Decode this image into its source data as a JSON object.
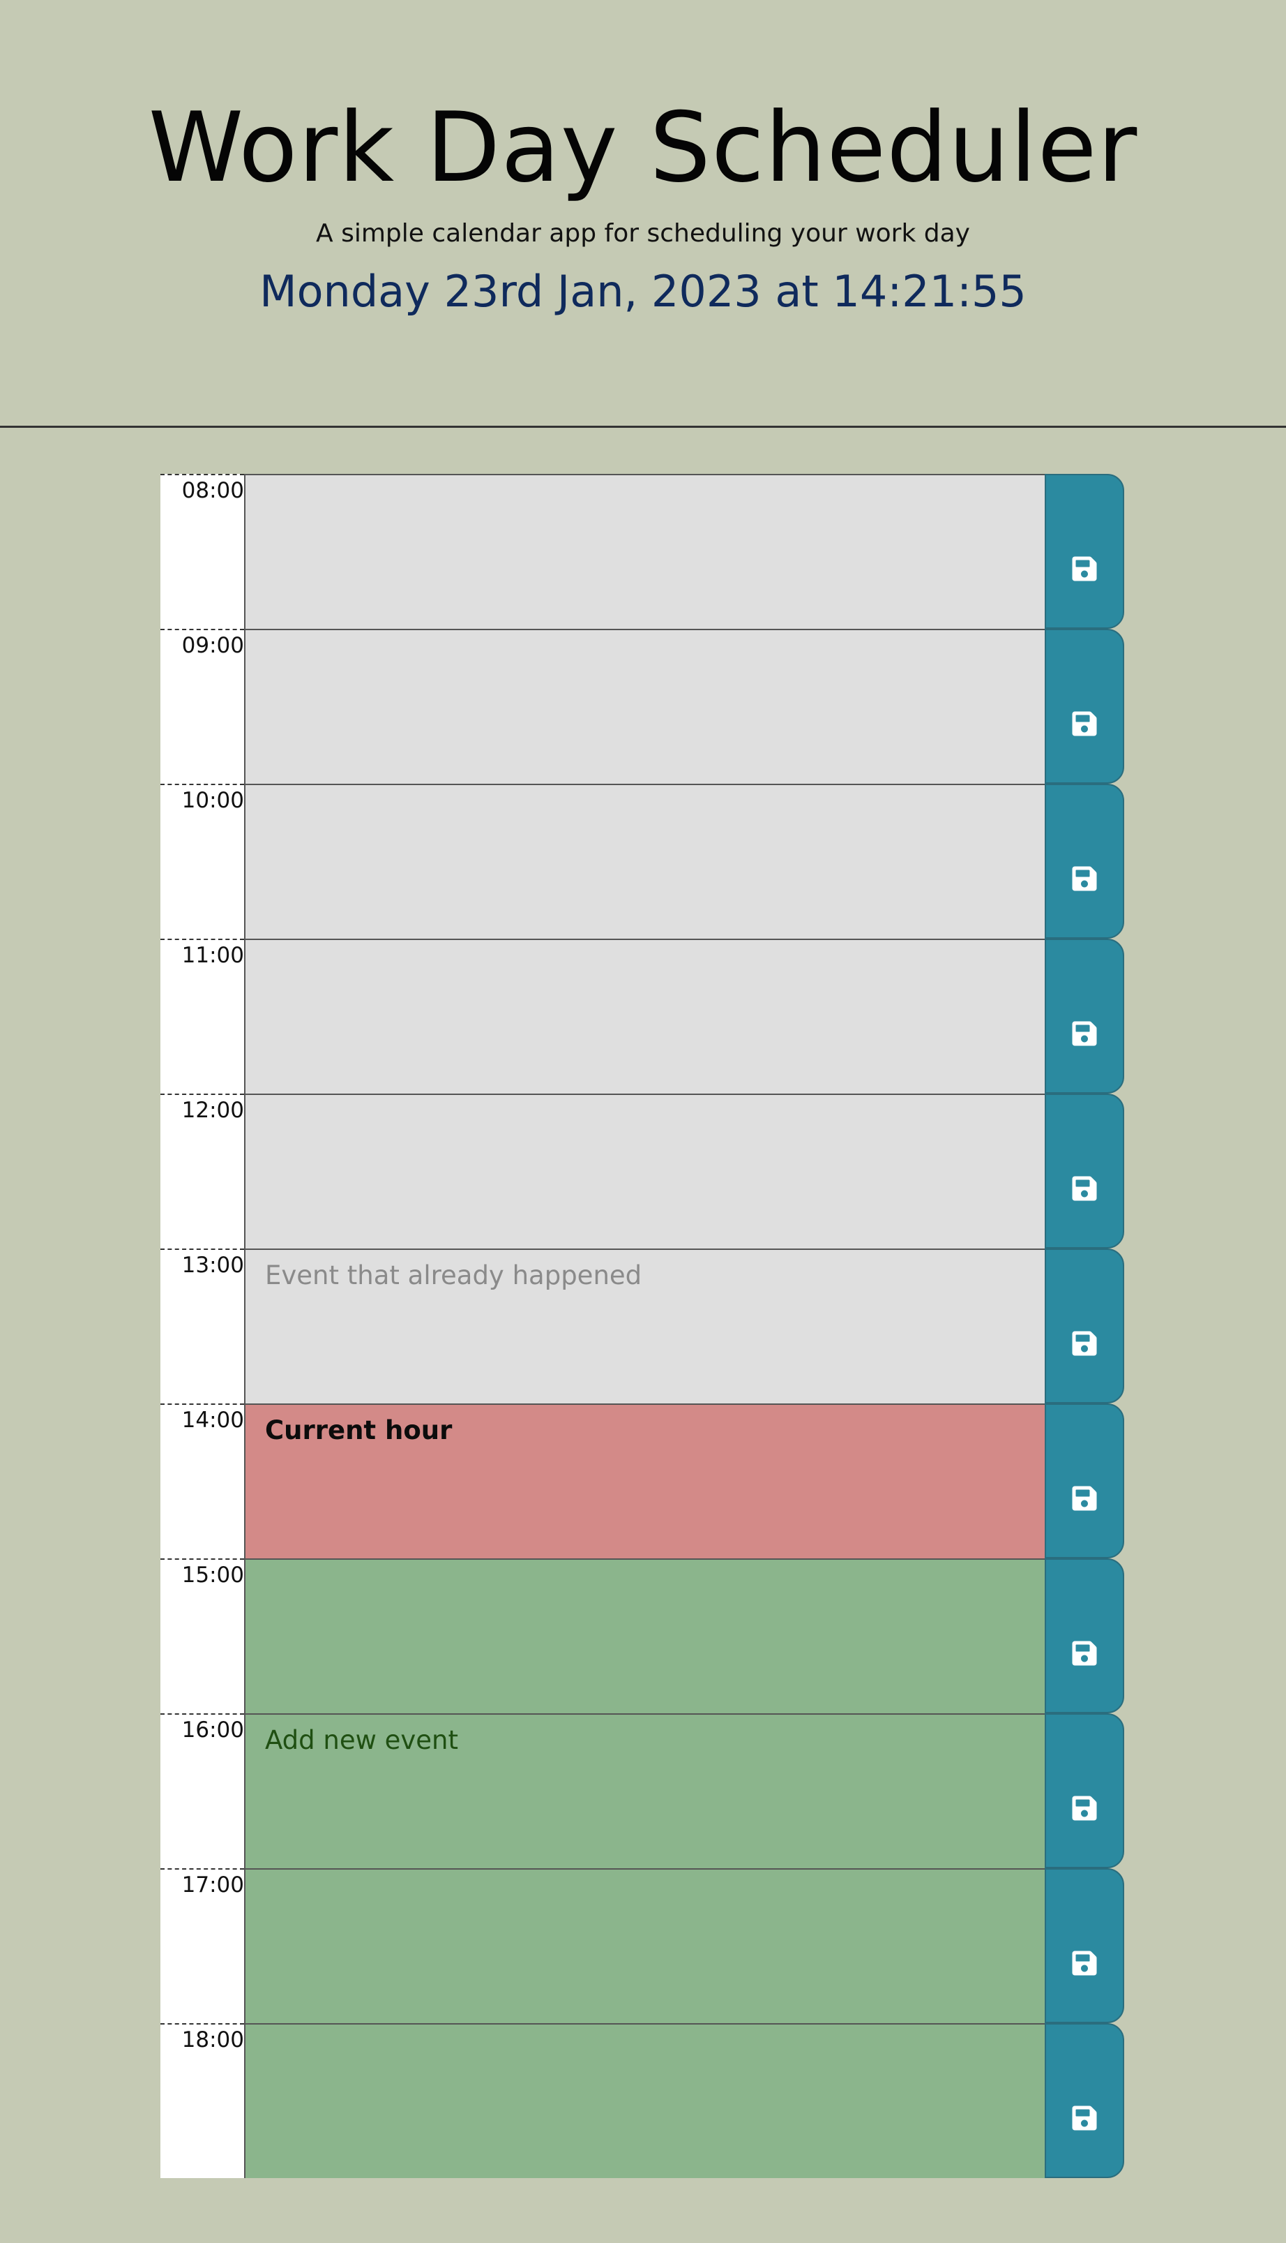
{
  "header": {
    "title": "Work Day Scheduler",
    "subtitle": "A simple calendar app for scheduling your work day",
    "datetime": "Monday 23rd Jan, 2023 at 14:21:55"
  },
  "colors": {
    "background": "#c5cab4",
    "past": "#dfdfdf",
    "present": "#d38a88",
    "future": "#8bb58c",
    "save_button": "#2b8aa0",
    "datetime_text": "#0f2a5c"
  },
  "save_icon": "floppy-disk-icon",
  "rows": [
    {
      "hour": "08:00",
      "text": "",
      "state": "past"
    },
    {
      "hour": "09:00",
      "text": "",
      "state": "past"
    },
    {
      "hour": "10:00",
      "text": "",
      "state": "past"
    },
    {
      "hour": "11:00",
      "text": "",
      "state": "past"
    },
    {
      "hour": "12:00",
      "text": "",
      "state": "past"
    },
    {
      "hour": "13:00",
      "text": "Event that already happened",
      "state": "past"
    },
    {
      "hour": "14:00",
      "text": "Current hour",
      "state": "present"
    },
    {
      "hour": "15:00",
      "text": "",
      "state": "future"
    },
    {
      "hour": "16:00",
      "text": "Add new event",
      "state": "future"
    },
    {
      "hour": "17:00",
      "text": "",
      "state": "future"
    },
    {
      "hour": "18:00",
      "text": "",
      "state": "future"
    }
  ]
}
